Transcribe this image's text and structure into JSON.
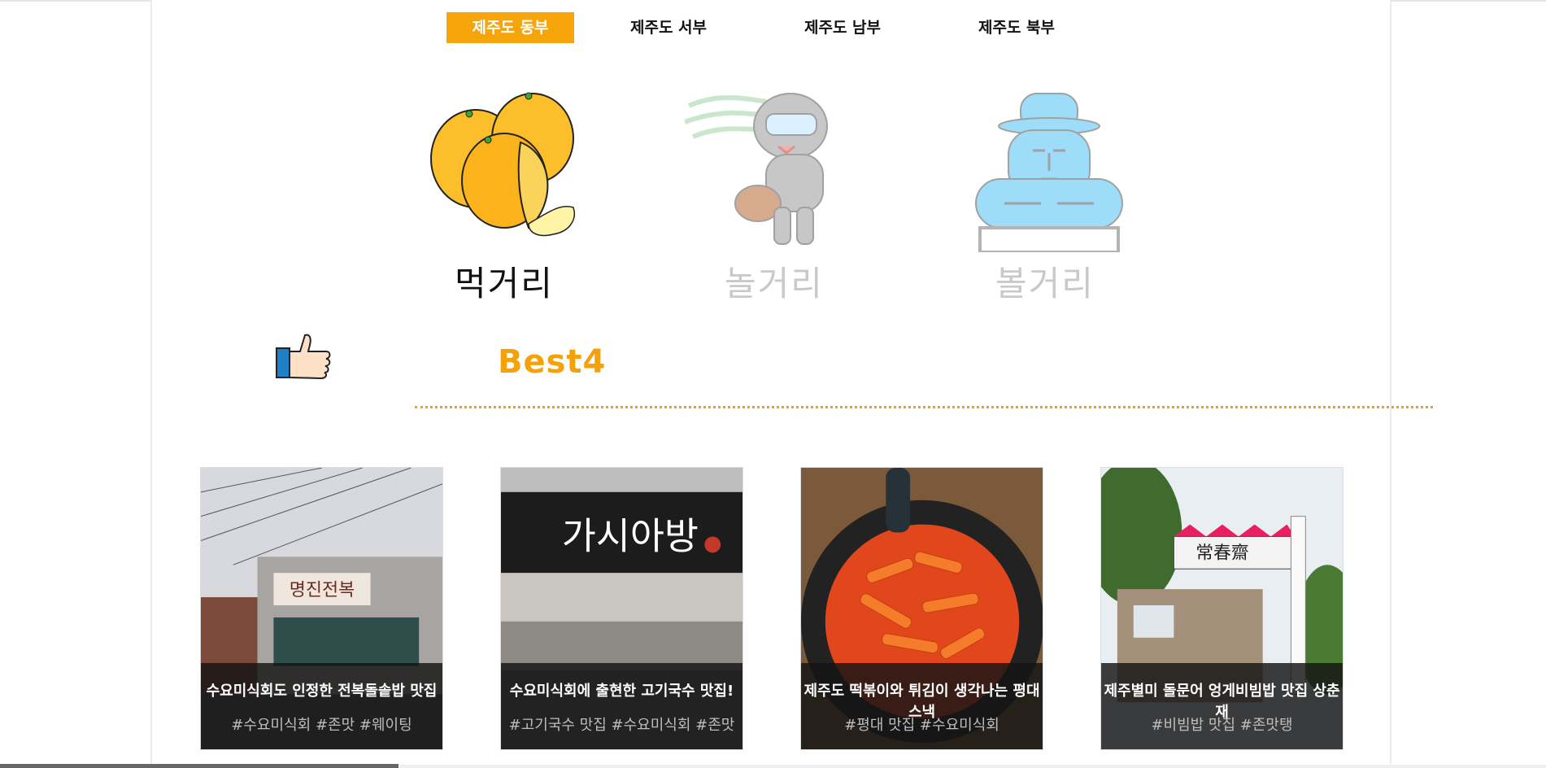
{
  "tabs": [
    {
      "label": "제주도 동부",
      "active": true
    },
    {
      "label": "제주도 서부",
      "active": false
    },
    {
      "label": "제주도 남부",
      "active": false
    },
    {
      "label": "제주도 북부",
      "active": false
    }
  ],
  "categories": [
    {
      "label": "먹거리",
      "active": true,
      "icon": "tangerine-icon"
    },
    {
      "label": "놀거리",
      "active": false,
      "icon": "diver-icon"
    },
    {
      "label": "볼거리",
      "active": false,
      "icon": "dolhareubang-icon"
    }
  ],
  "best": {
    "title": "Best4",
    "icon": "thumbs-up-icon",
    "accent": "#f5a20a"
  },
  "cards": [
    {
      "title": "수요미식회도 인정한 전복돌솥밥 맛집",
      "tags": "#수요미식회  #존맛  #웨이팅",
      "sign": "명진전복"
    },
    {
      "title": "수요미식회에 출현한 고기국수 맛집!",
      "tags": "#고기국수 맛집 #수요미식회 #존맛",
      "sign": "가시아방"
    },
    {
      "title": "제주도 떡볶이와 튀김이 생각나는 평대스낵",
      "tags": "#평대 맛집 #수요미식회",
      "sign": ""
    },
    {
      "title": "제주별미 돌문어 엉게비빔밥 맛집 상춘재",
      "tags": "#비빔밥 맛집 #존맛탱",
      "sign": "常春齋"
    }
  ]
}
